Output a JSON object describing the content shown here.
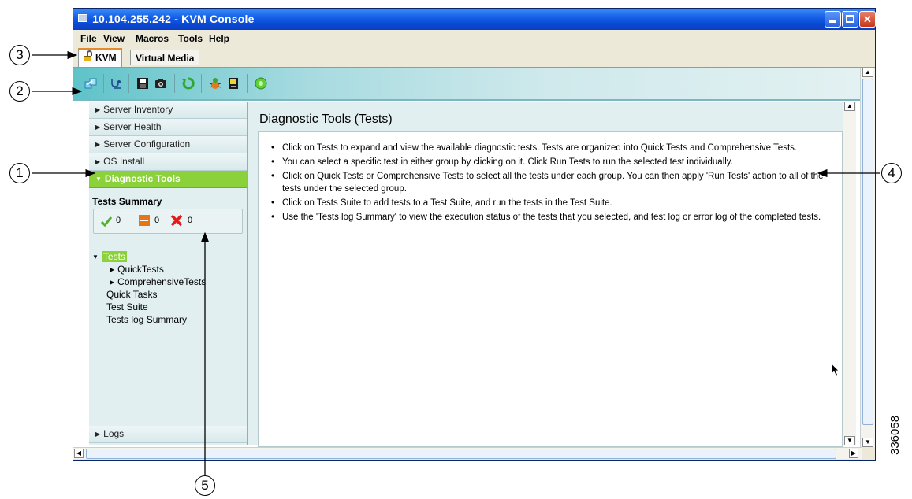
{
  "window": {
    "title": "10.104.255.242 - KVM Console"
  },
  "menu": [
    "File",
    "View",
    "Macros",
    "Tools",
    "Help"
  ],
  "tabs": [
    {
      "label": "KVM",
      "active": true
    },
    {
      "label": "Virtual Media",
      "active": false
    }
  ],
  "toolbar": {
    "icons": [
      "connect-icon",
      "stethoscope-icon",
      "save-icon",
      "camera-icon",
      "refresh-icon",
      "bug-icon",
      "battery-icon",
      "power-icon"
    ]
  },
  "nav": {
    "items": [
      "Server Inventory",
      "Server Health",
      "Server Configuration",
      "OS Install",
      "Diagnostic Tools"
    ],
    "active": "Diagnostic Tools",
    "logs": "Logs"
  },
  "summary": {
    "title": "Tests Summary",
    "passed": "0",
    "in_progress": "0",
    "failed": "0"
  },
  "tree": {
    "tests": "Tests",
    "quick_tests": "QuickTests",
    "comprehensive_tests": "ComprehensiveTests",
    "quick_tasks": "Quick Tasks",
    "test_suite": "Test Suite",
    "tests_log_summary": "Tests log Summary"
  },
  "main": {
    "title": "Diagnostic Tools (Tests)",
    "bullets": [
      "Click on Tests to expand and view the available diagnostic tests. Tests are organized into Quick Tests and Comprehensive Tests.",
      "You can select a specific test in either group by clicking on it. Click Run Tests to run the selected test individually.",
      "Click on Quick Tests or Comprehensive Tests to select all the tests under each group. You can then apply 'Run Tests' action to all of the tests under the selected group.",
      "Click on Tests Suite to add tests to a Test Suite, and run the tests in the Test Suite.",
      "Use the 'Tests log Summary' to view the execution status of the tests that you selected, and test log or error log of the completed tests."
    ]
  },
  "callouts": [
    "1",
    "2",
    "3",
    "4",
    "5"
  ],
  "figure_id": "336058",
  "colors": {
    "titlebar": "#0a4bd6",
    "active_green": "#8bd13a",
    "toolbar_teal": "#5ec3c9"
  }
}
